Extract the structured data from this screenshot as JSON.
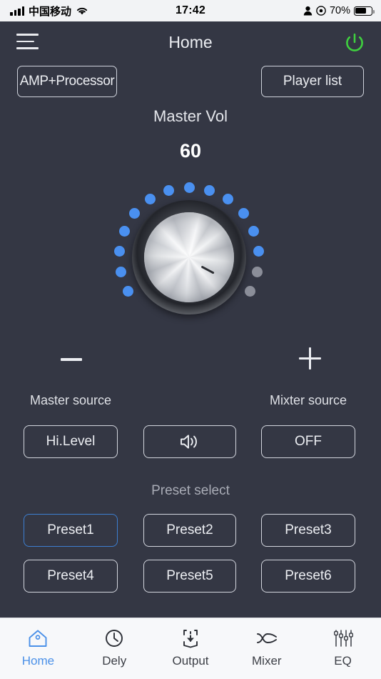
{
  "status_bar": {
    "carrier": "中国移动",
    "time": "17:42",
    "battery_percent": "70%",
    "signal_icon": "signal-bars-icon",
    "wifi_icon": "wifi-icon",
    "person_icon": "person-icon",
    "location_icon": "location-icon",
    "battery_icon": "battery-icon"
  },
  "header": {
    "menu_icon": "hamburger-menu-icon",
    "title": "Home",
    "power_icon": "power-icon",
    "power_color": "#3fd03f",
    "amp_button": "AMP+Processor",
    "player_button": "Player list"
  },
  "master_volume": {
    "label": "Master Vol",
    "value": "60",
    "min": 0,
    "max": 100,
    "decrease_icon": "minus-icon",
    "increase_icon": "plus-icon",
    "dots_total": 15,
    "dots_active": 13,
    "active_color": "#4a90f0",
    "inactive_color": "#8b8e99"
  },
  "sources": {
    "master_label": "Master source",
    "mixter_label": "Mixter source",
    "master_value": "Hi.Level",
    "mute_icon": "speaker-volume-icon",
    "mixter_value": "OFF"
  },
  "presets": {
    "title": "Preset select",
    "selected": "Preset1",
    "selected_border_color": "#3d7fd1",
    "items": [
      {
        "label": "Preset1",
        "selected": true
      },
      {
        "label": "Preset2",
        "selected": false
      },
      {
        "label": "Preset3",
        "selected": false
      },
      {
        "label": "Preset4",
        "selected": false
      },
      {
        "label": "Preset5",
        "selected": false
      },
      {
        "label": "Preset6",
        "selected": false
      }
    ]
  },
  "tabbar": {
    "active": "Home",
    "active_color": "#4a90e8",
    "items": [
      {
        "label": "Home",
        "icon": "home-icon"
      },
      {
        "label": "Dely",
        "icon": "clock-icon"
      },
      {
        "label": "Output",
        "icon": "output-download-icon"
      },
      {
        "label": "Mixer",
        "icon": "shuffle-cross-icon"
      },
      {
        "label": "EQ",
        "icon": "equalizer-sliders-icon"
      }
    ]
  },
  "theme": {
    "background": "#343744",
    "text": "#eceef2",
    "muted_text": "#a9acb6",
    "border": "#d3d6de"
  }
}
